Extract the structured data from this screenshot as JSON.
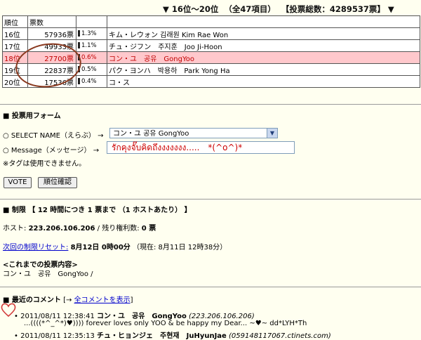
{
  "header": {
    "range": "▼ 16位～20位",
    "count": "（全47項目）",
    "total": "【投票総数：4289537票】 ▼"
  },
  "table": {
    "col_rank": "順位",
    "col_votes": "票数",
    "rows": [
      {
        "rank": "16位",
        "votes": "57936票",
        "pct": "1.3%",
        "name": "キム・レウォン 김래원 Kim Rae Won"
      },
      {
        "rank": "17位",
        "votes": "49933票",
        "pct": "1.1%",
        "name": "チュ・ジフン　주지훈　Joo Ji-Hoon"
      },
      {
        "rank": "18位",
        "votes": "27700票",
        "pct": "0.6%",
        "name": "コン・ユ　공유　GongYoo"
      },
      {
        "rank": "19位",
        "votes": "22837票",
        "pct": "0.5%",
        "name": "パク・ヨンハ　박용하　Park Yong Ha"
      },
      {
        "rank": "20位",
        "votes": "17536票",
        "pct": "0.4%",
        "name": "コ・ス"
      }
    ]
  },
  "form": {
    "title": "■ 投票用フォーム",
    "select_label": "○ SELECT NAME（えらぶ） →",
    "select_value": "コン・ユ 공유 GongYoo",
    "message_label": "○ Message（メッセージ） →",
    "message_value": "รักคุงจั๊บคิดถึงงงงงงง.....　*(^o^)*",
    "tag_note": "※タグは使用できません。",
    "vote_button": "VOTE",
    "rank_button": "順位確認"
  },
  "limit": {
    "title": "■ 制限 【 12 時間につき 1 票まで （1 ホストあたり） 】",
    "host_label": "ホスト:",
    "host_value": "223.206.106.206",
    "remaining_label": "/ 残り権利数:",
    "remaining_value": "0 票",
    "reset_label": "次回の制限リセット:",
    "reset_value": "8月12日 0時00分",
    "now_text": "（現在: 8月11日 12時38分）"
  },
  "history": {
    "title": "<これまでの投票内容>",
    "value": "コン・ユ　공유　GongYoo /"
  },
  "comments": {
    "title": "■ 最近のコメント",
    "link_prefix": "[→",
    "link_text": "全コメントを表示",
    "link_suffix": "]",
    "items": [
      {
        "date": "2011/08/11 12:38:41",
        "name": "コン・ユ　공유　GongYoo",
        "host": "(223.206.106.206)",
        "text": "...((((*^_^*)♥)))) forever loves only YOO & be happy my Dear... ~♥~ dd*LYH*Th"
      },
      {
        "date": "2011/08/11 12:35:13",
        "name": "チュ・ヒョンジェ　주현재　JuHyunJae",
        "host": "(059148117067.ctinets.com)",
        "text": ""
      }
    ]
  },
  "colors": {
    "highlight_bg": "#ffc8cc",
    "highlight_text": "#c00000",
    "link": "#0000cc",
    "page_bg": "#fffff0"
  }
}
